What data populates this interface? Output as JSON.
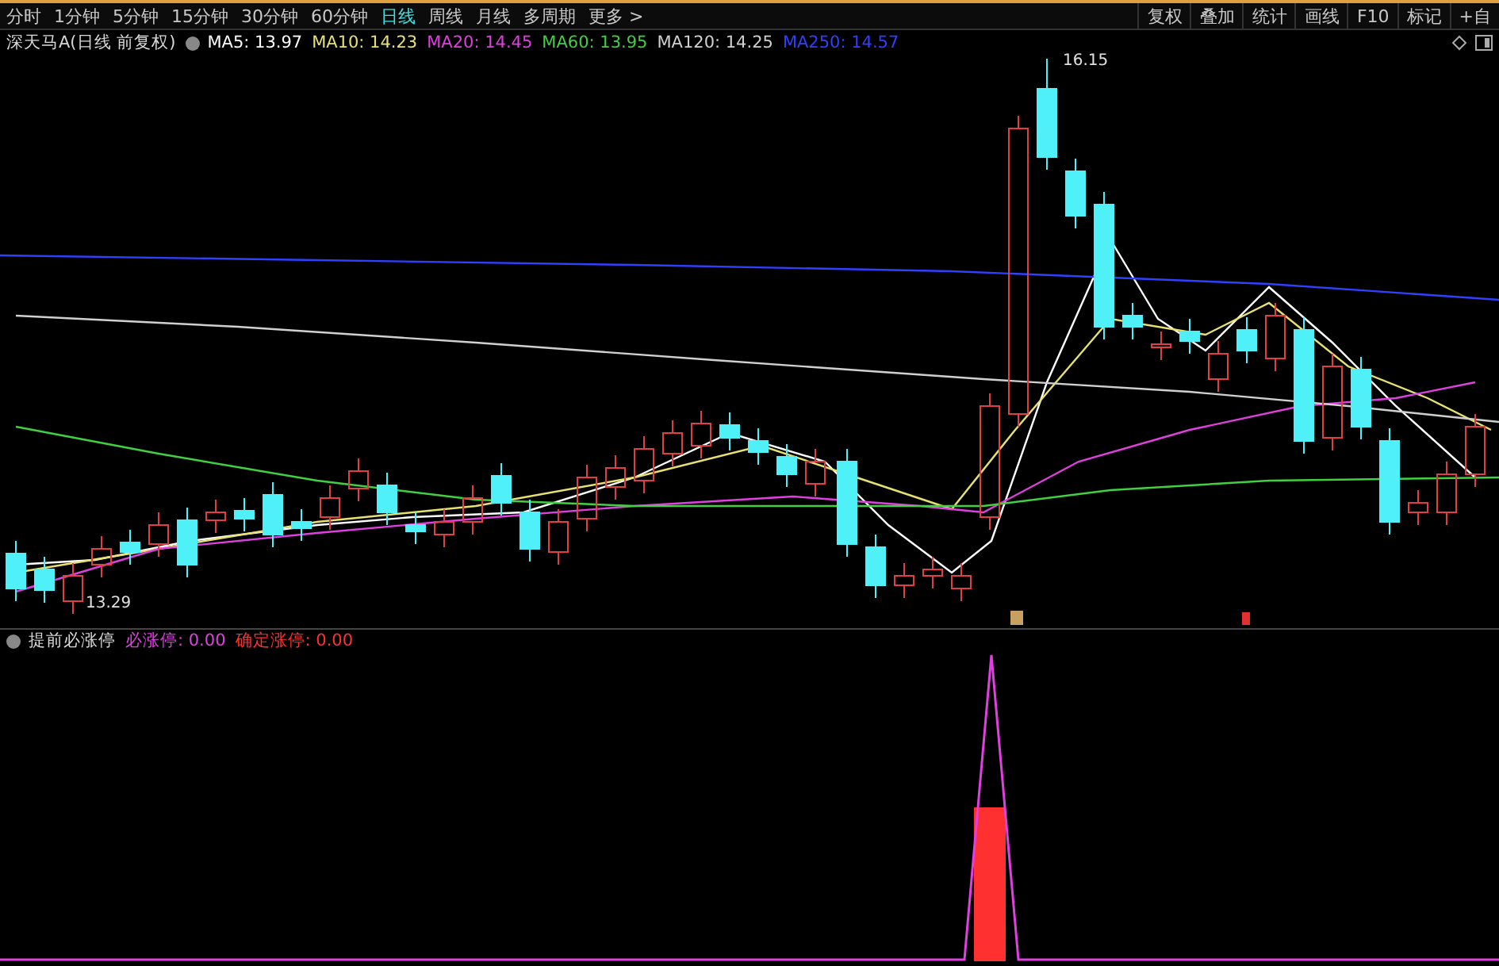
{
  "toolbar": {
    "periods": [
      {
        "label": "分时",
        "selected": false
      },
      {
        "label": "1分钟",
        "selected": false
      },
      {
        "label": "5分钟",
        "selected": false
      },
      {
        "label": "15分钟",
        "selected": false
      },
      {
        "label": "30分钟",
        "selected": false
      },
      {
        "label": "60分钟",
        "selected": false
      },
      {
        "label": "日线",
        "selected": true
      },
      {
        "label": "周线",
        "selected": false
      },
      {
        "label": "月线",
        "selected": false
      },
      {
        "label": "多周期",
        "selected": false
      },
      {
        "label": "更多 >",
        "selected": false
      }
    ],
    "actions": [
      "复权",
      "叠加",
      "统计",
      "画线",
      "F10",
      "标记",
      "+自"
    ]
  },
  "legend": {
    "title": "深天马A(日线 前复权)",
    "averages": [
      {
        "label": "MA5: 13.97",
        "color": "#ffffff"
      },
      {
        "label": "MA10: 14.23",
        "color": "#e8e070"
      },
      {
        "label": "MA20: 14.45",
        "color": "#e040e0"
      },
      {
        "label": "MA60: 13.95",
        "color": "#40d040"
      },
      {
        "label": "MA120: 14.25",
        "color": "#d0d0d0"
      },
      {
        "label": "MA250: 14.57",
        "color": "#3040ff"
      }
    ]
  },
  "chart": {
    "high_label": "16.15",
    "low_label": "13.29"
  },
  "indicator": {
    "title": "提前必涨停",
    "values": [
      {
        "label": "必涨停: 0.00",
        "color": "#e040e0"
      },
      {
        "label": "确定涨停: 0.00",
        "color": "#ff3030"
      }
    ]
  }
}
